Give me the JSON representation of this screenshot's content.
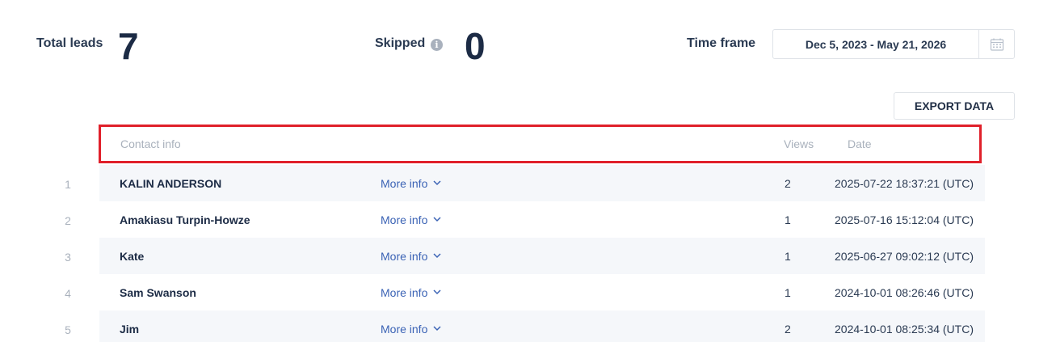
{
  "stats": {
    "total_leads_label": "Total leads",
    "total_leads_value": "7",
    "skipped_label": "Skipped",
    "skipped_value": "0",
    "time_frame_label": "Time frame"
  },
  "date_range": {
    "value": "Dec 5, 2023 - May 21, 2026",
    "icon": "calendar-icon"
  },
  "export_label": "EXPORT DATA",
  "table": {
    "headers": {
      "contact": "Contact info",
      "views": "Views",
      "date": "Date"
    },
    "rows": [
      {
        "num": "1",
        "name": "KALIN ANDERSON",
        "more": "More info",
        "views": "2",
        "date": "2025-07-22 18:37:21 (UTC)"
      },
      {
        "num": "2",
        "name": "Amakiasu Turpin-Howze",
        "more": "More info",
        "views": "1",
        "date": "2025-07-16 15:12:04 (UTC)"
      },
      {
        "num": "3",
        "name": "Kate",
        "more": "More info",
        "views": "1",
        "date": "2025-06-27 09:02:12 (UTC)"
      },
      {
        "num": "4",
        "name": "Sam Swanson",
        "more": "More info",
        "views": "1",
        "date": "2024-10-01 08:26:46 (UTC)"
      },
      {
        "num": "5",
        "name": "Jim",
        "more": "More info",
        "views": "2",
        "date": "2024-10-01 08:25:34 (UTC)"
      }
    ]
  },
  "colors": {
    "highlight_border": "#e0202a",
    "link": "#3b63b5",
    "row_shade": "#f5f7fa"
  }
}
